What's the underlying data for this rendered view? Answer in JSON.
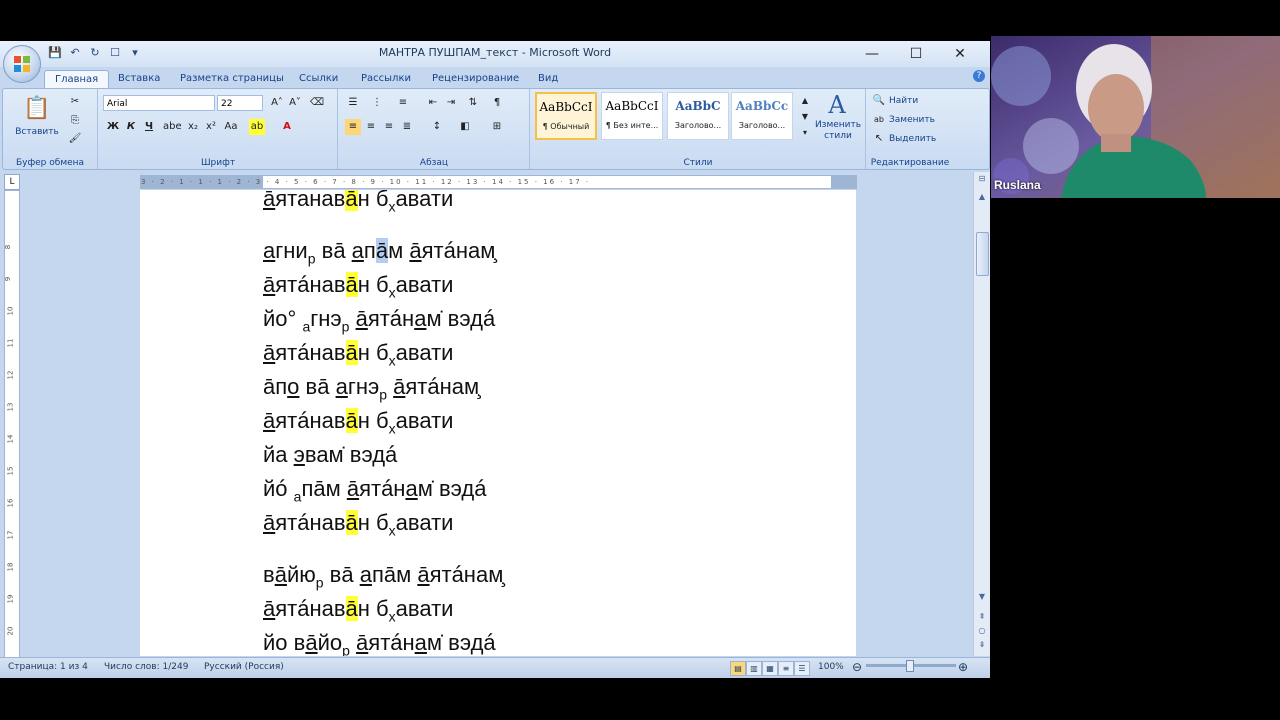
{
  "window": {
    "title": "МАНТРА ПУШПАМ_текст - Microsoft Word"
  },
  "tabs": [
    "Главная",
    "Вставка",
    "Разметка страницы",
    "Ссылки",
    "Рассылки",
    "Рецензирование",
    "Вид"
  ],
  "ribbon": {
    "clipboard": {
      "paste_label": "Вставить",
      "group_label": "Буфер обмена"
    },
    "font": {
      "name": "Arial",
      "size": "22",
      "group_label": "Шрифт",
      "bold": "Ж",
      "italic": "К",
      "underline": "Ч"
    },
    "paragraph": {
      "group_label": "Абзац"
    },
    "styles": {
      "group_label": "Стили",
      "items": [
        {
          "sample": "AaBbCcI",
          "name": "¶ Обычный"
        },
        {
          "sample": "AaBbCcI",
          "name": "¶ Без инте..."
        },
        {
          "sample": "AaBbC",
          "name": "Заголово..."
        },
        {
          "sample": "AaBbCc",
          "name": "Заголово..."
        }
      ],
      "change_label_1": "Изменить",
      "change_label_2": "стили"
    },
    "editing": {
      "group_label": "Редактирование",
      "find": "Найти",
      "replace": "Заменить",
      "select": "Выделить"
    }
  },
  "ruler_numbers": "3 · 2 · 1 · 1 · 1 · 2 · 3 · 4 · 5 · 6 · 7 · 8 · 9 · 10 · 11 · 12 · 13 · 14 · 15 · 16 · 17 ·",
  "document": {
    "lines": [
      {
        "html": "<span class='u'>ā</span>ятанав<span class='hl'>ā</span>н б<sub style='font-size:14px'>х</sub>авати"
      },
      {
        "html": "<span class='u'>а</span>гни<sub style='font-size:14px'>р</sub> вā <span class='u'>а</span>п<span class='sel'>ā</span>м <span class='u'>ā</span>ятáнам̧"
      },
      {
        "html": "<span class='u'>ā</span>ятáнав<span class='hl'>ā</span>н б<sub style='font-size:14px'>х</sub>авати"
      },
      {
        "html": "йо° <sub style='font-size:14px'>а</sub>гнэ<sub style='font-size:14px'>р</sub> <span class='u'>ā</span>ятáн<span class='u'>а</span>м̇ вэдá"
      },
      {
        "html": "<span class='u'>ā</span>ятáнав<span class='hl'>ā</span>н б<sub style='font-size:14px'>х</sub>авати"
      },
      {
        "html": "āп<span class='u'>о</span> вā <span class='u'>а</span>гнэ<sub style='font-size:14px'>р</sub> <span class='u'>ā</span>ятáнам̧"
      },
      {
        "html": "<span class='u'>ā</span>ятáнав<span class='hl'>ā</span>н б<sub style='font-size:14px'>х</sub>авати"
      },
      {
        "html": "йа <span class='u'>э</span>вам̇ вэдá"
      },
      {
        "html": "йó <sub style='font-size:14px'>а</sub>пāм <span class='u'>ā</span>ятáн<span class='u'>а</span>м̇ вэдá"
      },
      {
        "html": "<span class='u'>ā</span>ятáнав<span class='hl'>ā</span>н б<sub style='font-size:14px'>х</sub>авати"
      },
      {
        "html": "в<span class='u'>ā</span>йю<sub style='font-size:14px'>р</sub> вā <span class='u'>а</span>пāм <span class='u'>ā</span>ятáнам̧"
      },
      {
        "html": "<span class='u'>ā</span>ятáнав<span class='hl'>ā</span>н б<sub style='font-size:14px'>х</sub>авати"
      },
      {
        "html": "йо в<span class='u'>ā</span>йо<sub style='font-size:14px'>р</sub> <span class='u'>ā</span>ятáн<span class='u'>а</span>м̇ вэдá"
      }
    ]
  },
  "status": {
    "page": "Страница: 1 из 4",
    "words": "Число слов: 1/249",
    "language": "Русский (Россия)",
    "zoom": "100%"
  },
  "video": {
    "participant": "Ruslana"
  }
}
